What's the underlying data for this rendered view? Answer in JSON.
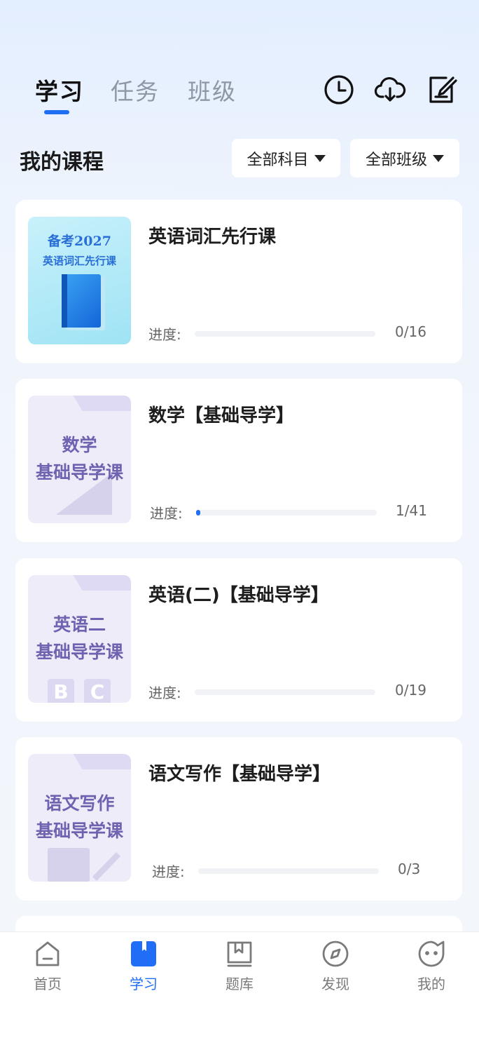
{
  "top_tabs": [
    "学习",
    "任务",
    "班级"
  ],
  "top_icons": [
    "history-clock-icon",
    "cloud-download-icon",
    "edit-note-icon"
  ],
  "section_title": "我的课程",
  "filters": {
    "subject": "全部科目",
    "class": "全部班级"
  },
  "courses": [
    {
      "title": "英语词汇先行课",
      "cover_line1": "备考2027",
      "cover_line2": "英语词汇先行课",
      "progress_label": "进度:",
      "progress_count": "0/16",
      "progress_value": 0,
      "progress_total": 16
    },
    {
      "title": "数学【基础导学】",
      "cover_line1": "数学",
      "cover_line2": "基础导学课",
      "progress_label": "进度:",
      "progress_count": "1/41",
      "progress_value": 1,
      "progress_total": 41
    },
    {
      "title": "英语(二)【基础导学】",
      "cover_line1": "英语二",
      "cover_line2": "基础导学课",
      "progress_label": "进度:",
      "progress_count": "0/19",
      "progress_value": 0,
      "progress_total": 19
    },
    {
      "title": "语文写作【基础导学】",
      "cover_line1": "语文写作",
      "cover_line2": "基础导学课",
      "progress_label": "进度:",
      "progress_count": "0/3",
      "progress_value": 0,
      "progress_total": 3
    }
  ],
  "cover_deco_letters": [
    "B",
    "C"
  ],
  "bottom_nav": [
    {
      "label": "首页",
      "icon": "home-icon"
    },
    {
      "label": "学习",
      "icon": "book-icon"
    },
    {
      "label": "题库",
      "icon": "question-bank-icon"
    },
    {
      "label": "发现",
      "icon": "compass-icon"
    },
    {
      "label": "我的",
      "icon": "profile-face-icon"
    }
  ],
  "colors": {
    "accent": "#1f6ef5",
    "cover_purple_text": "#6f62b0",
    "cover_blue_text": "#2a6fd6"
  }
}
